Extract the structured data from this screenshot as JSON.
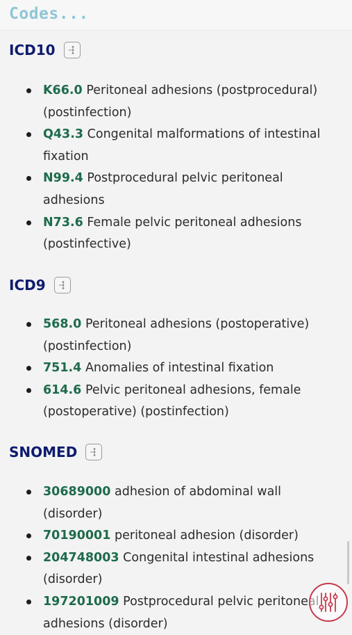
{
  "header": {
    "title": "Codes..."
  },
  "sections": [
    {
      "title": "ICD10",
      "items": [
        {
          "code": "K66.0",
          "desc": "Peritoneal adhesions (postprocedural) (postinfection)"
        },
        {
          "code": "Q43.3",
          "desc": "Congenital malformations of intestinal fixation"
        },
        {
          "code": "N99.4",
          "desc": "Postprocedural pelvic peritoneal adhesions"
        },
        {
          "code": "N73.6",
          "desc": "Female pelvic peritoneal adhesions (postinfective)"
        }
      ]
    },
    {
      "title": "ICD9",
      "items": [
        {
          "code": "568.0",
          "desc": "Peritoneal adhesions (postoperative) (postinfection)"
        },
        {
          "code": "751.4",
          "desc": "Anomalies of intestinal fixation"
        },
        {
          "code": "614.6",
          "desc": "Pelvic peritoneal adhesions, female (postoperative) (postinfection)"
        }
      ]
    },
    {
      "title": "SNOMED",
      "items": [
        {
          "code": "30689000",
          "desc": "adhesion of abdominal wall (disorder)"
        },
        {
          "code": "70190001",
          "desc": "peritoneal adhesion (disorder)"
        },
        {
          "code": "204748003",
          "desc": "Congenital intestinal adhesions (disorder)"
        },
        {
          "code": "197201009",
          "desc": "Postprocedural pelvic peritoneal adhesions (disorder)"
        }
      ]
    }
  ],
  "colors": {
    "header_title": "#8fc6d6",
    "section_title": "#0e1b6e",
    "code": "#1e6b4b",
    "fab_accent": "#c8394c"
  },
  "icons": {
    "section_button": "hierarchy-tree-icon",
    "fab": "filter-sliders-icon"
  }
}
